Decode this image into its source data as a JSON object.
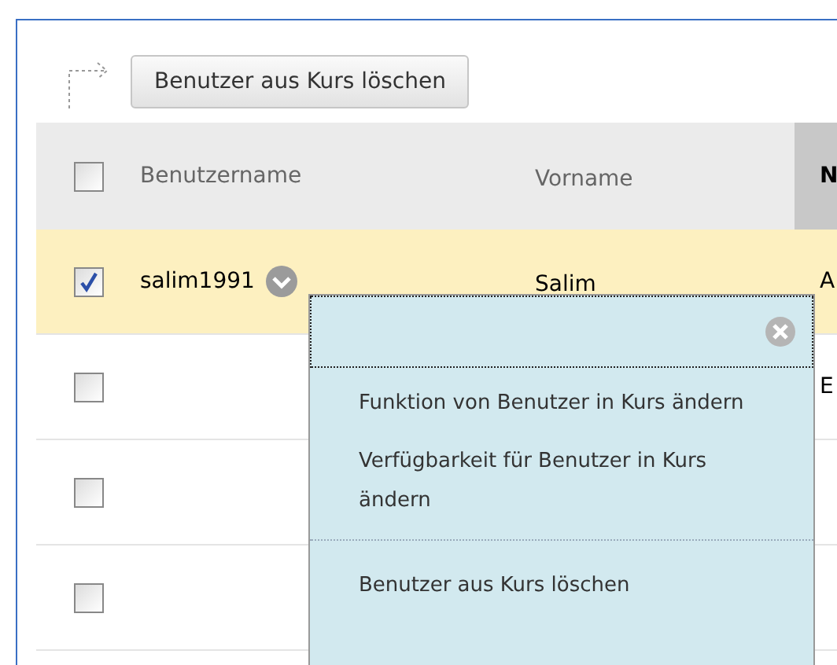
{
  "toolbar": {
    "button": "Benutzer aus Kurs löschen"
  },
  "table": {
    "select_all": {
      "checked": false
    },
    "columns": [
      "Benutzername",
      "Vorname",
      "N"
    ],
    "rows": [
      {
        "checked": true,
        "selected": true,
        "username": "salim1991",
        "first_name": "Salim",
        "column_3": "A"
      },
      {
        "checked": false,
        "selected": false,
        "column_3": "E"
      },
      {
        "checked": false,
        "selected": false
      },
      {
        "checked": false,
        "selected": false
      }
    ]
  },
  "context_menu": {
    "items": [
      {
        "kind": "item",
        "label": "Funktion von Benutzer in Kurs ändern"
      },
      {
        "kind": "item",
        "label": "Verfügbarkeit für Benutzer in Kurs ändern"
      },
      {
        "kind": "separator"
      },
      {
        "kind": "item",
        "label": "Benutzer aus Kurs löschen"
      }
    ]
  }
}
